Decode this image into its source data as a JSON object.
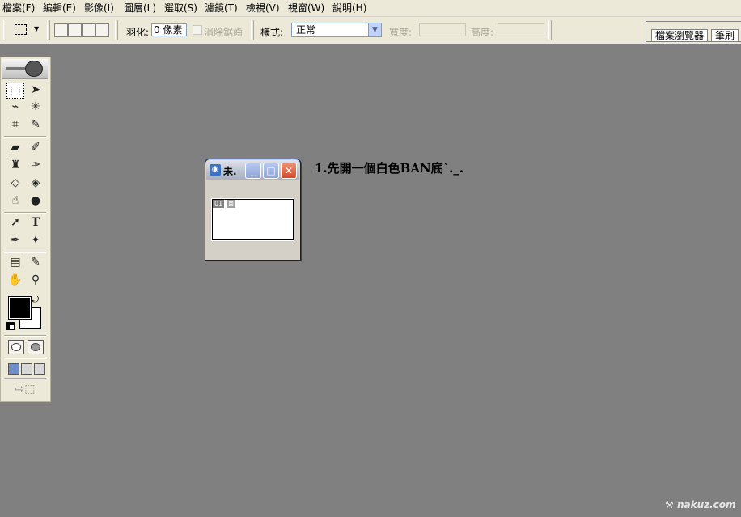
{
  "menu": [
    {
      "label": "檔案(F)"
    },
    {
      "label": "編輯(E)"
    },
    {
      "label": "影像(I)"
    },
    {
      "label": "圖層(L)"
    },
    {
      "label": "選取(S)"
    },
    {
      "label": "濾鏡(T)"
    },
    {
      "label": "檢視(V)"
    },
    {
      "label": "視窗(W)"
    },
    {
      "label": "說明(H)"
    }
  ],
  "options_bar": {
    "marquee_tool_icon": "rect-marquee-icon",
    "feather_label": "羽化:",
    "feather_value": "0 像素",
    "antialias_label": "消除鋸齒",
    "style_label": "樣式:",
    "style_value": "正常",
    "width_label": "寬度:",
    "height_label": "高度:",
    "tabs": {
      "file_browser": "檔案瀏覽器",
      "brushes": "筆刷"
    }
  },
  "colors": {
    "foreground": "#000000",
    "background": "#FFFFFF",
    "workspace": "#808080"
  },
  "document": {
    "title": "未.",
    "layer_badge": "01",
    "controls": {
      "minimize": "_",
      "maximize": "□",
      "close": "✕"
    }
  },
  "annotation": {
    "text": "1.先開一個白色BAN底`._."
  },
  "watermark": {
    "text": "nakuz.com"
  }
}
